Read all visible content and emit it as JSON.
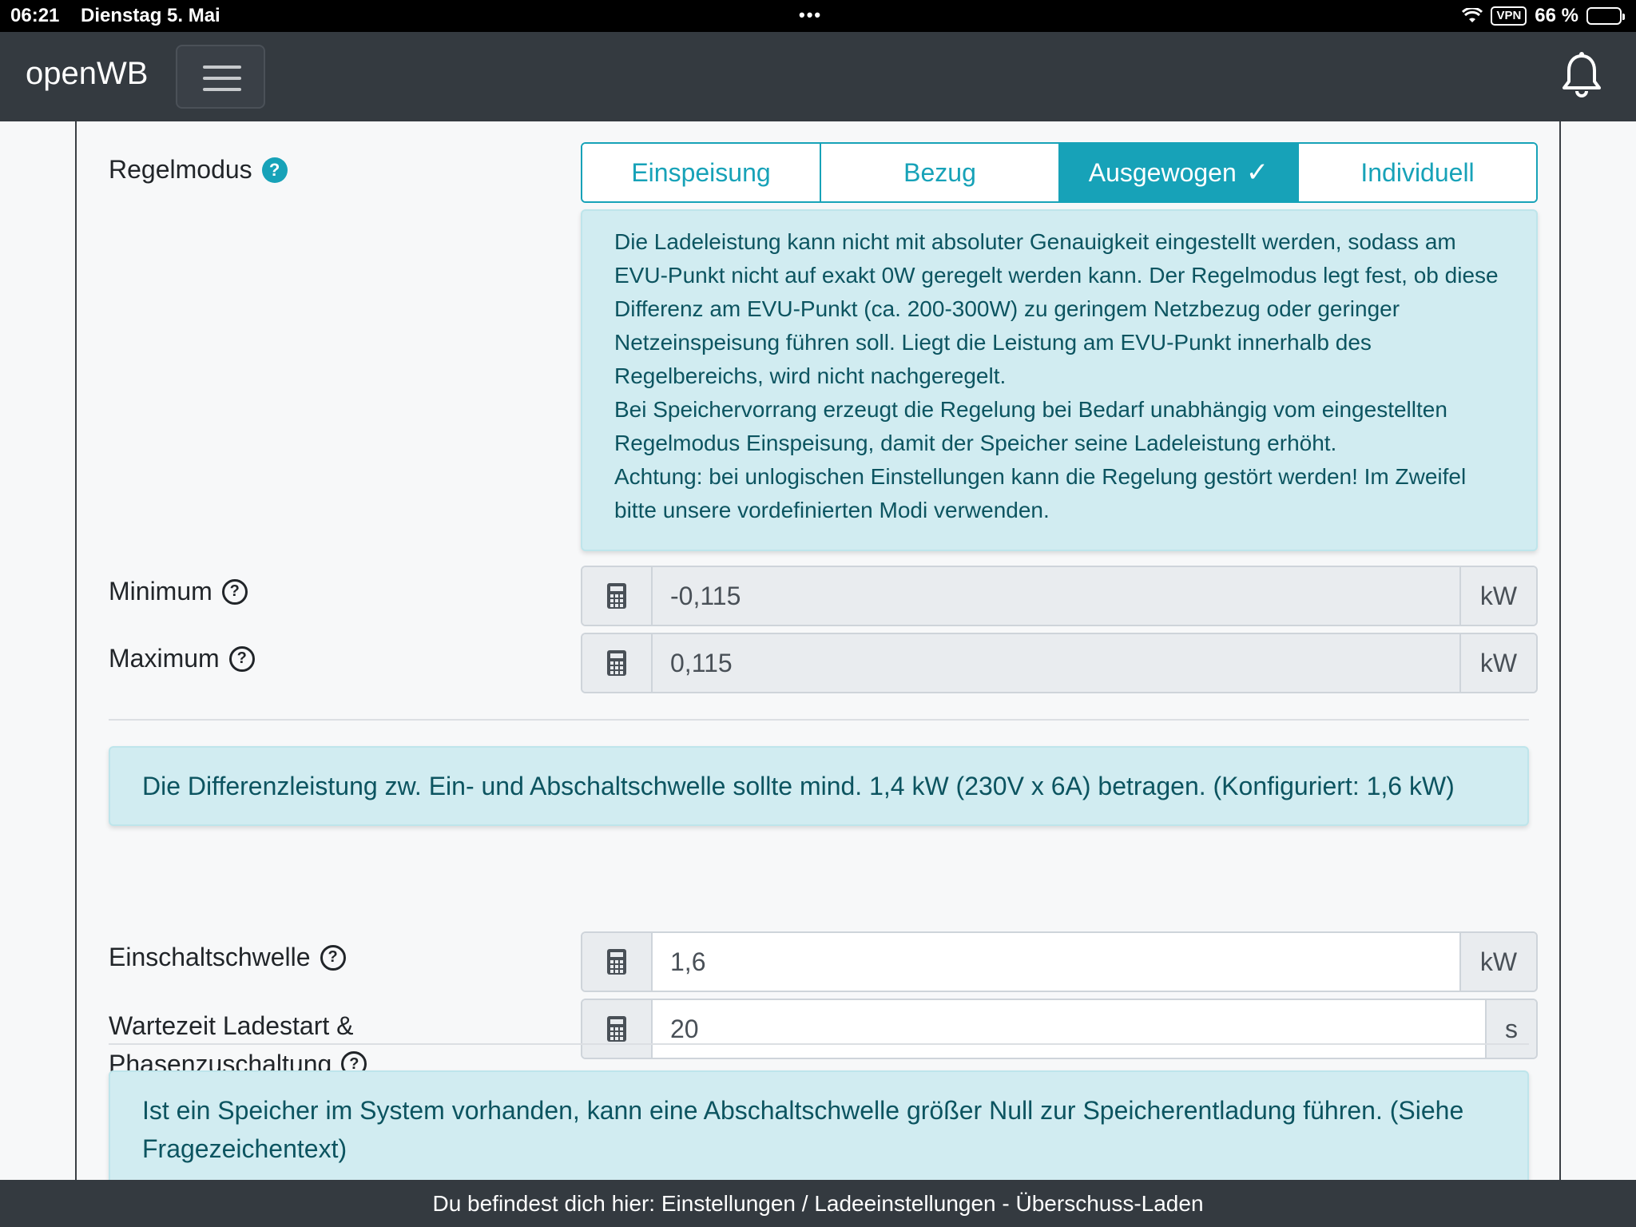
{
  "status_bar": {
    "time": "06:21",
    "date": "Dienstag 5. Mai",
    "vpn": "VPN",
    "battery": "66 %",
    "battery_level": 0.66
  },
  "navbar": {
    "brand": "openWB"
  },
  "regelmodus": {
    "label": "Regelmodus",
    "options": [
      "Einspeisung",
      "Bezug",
      "Ausgewogen",
      "Individuell"
    ],
    "selected": "Ausgewogen",
    "info": [
      "Die Ladeleistung kann nicht mit absoluter Genauigkeit eingestellt werden, sodass am EVU-Punkt nicht auf exakt 0W geregelt werden kann. Der Regelmodus legt fest, ob diese Differenz am EVU-Punkt (ca. 200-300W) zu geringem Netzbezug oder geringer Netzeinspeisung führen soll. Liegt die Leistung am EVU-Punkt innerhalb des Regelbereichs, wird nicht nachgeregelt.",
      "Bei Speichervorrang erzeugt die Regelung bei Bedarf unabhängig vom eingestellten Regelmodus Einspeisung, damit der Speicher seine Ladeleistung erhöht.",
      "Achtung: bei unlogischen Einstellungen kann die Regelung gestört werden! Im Zweifel bitte unsere vordefinierten Modi verwenden."
    ]
  },
  "minimum": {
    "label": "Minimum",
    "value": "-0,115",
    "unit": "kW"
  },
  "maximum": {
    "label": "Maximum",
    "value": "0,115",
    "unit": "kW"
  },
  "diff_info": "Die Differenzleistung zw. Ein- und Abschaltschwelle sollte mind. 1,4 kW (230V x 6A) betragen. (Konfiguriert: 1,6 kW)",
  "einschaltschwelle": {
    "label": "Einschaltschwelle",
    "value": "1,6",
    "unit": "kW"
  },
  "wartezeit": {
    "label_line1": "Wartezeit Ladestart &",
    "label_line2": "Phasenzuschaltung",
    "value": "20",
    "unit": "s"
  },
  "speicher_info": "Ist ein Speicher im System vorhanden, kann eine Abschaltschwelle größer Null zur Speicherentladung führen. (Siehe Fragezeichentext)",
  "footer": "Du befindest dich hier: Einstellungen / Ladeeinstellungen - Überschuss-Laden",
  "colors": {
    "accent": "#17a2b8",
    "navbar": "#343a40",
    "info_bg": "#d1ecf1",
    "info_text": "#0c5460"
  }
}
